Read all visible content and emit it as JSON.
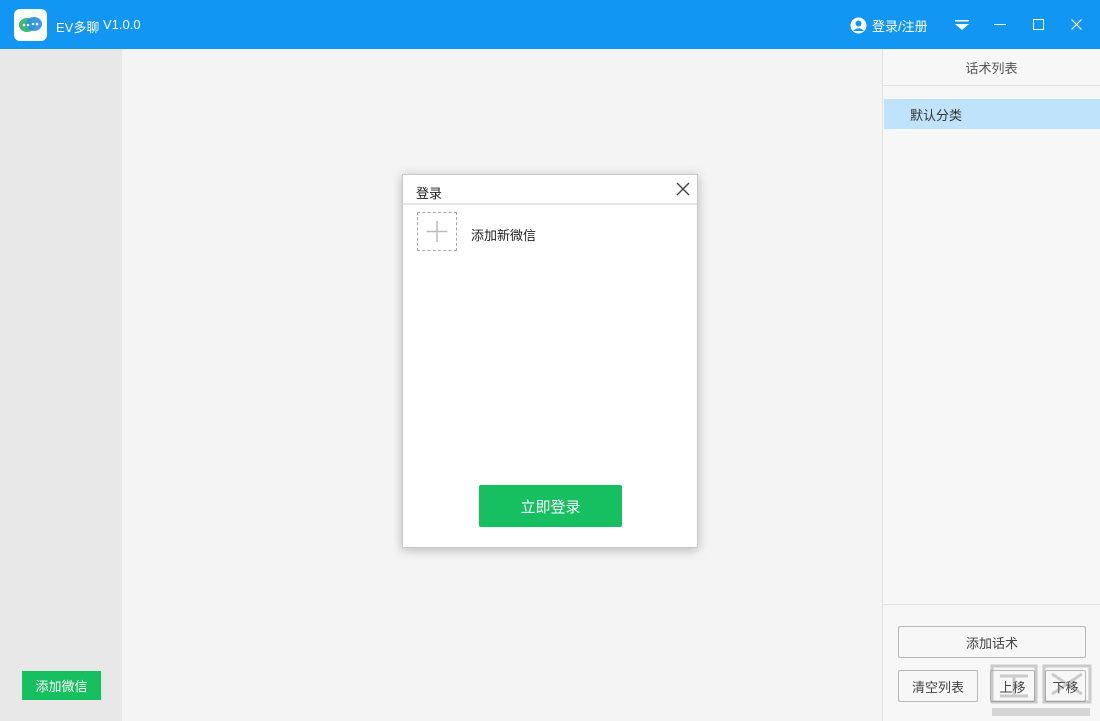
{
  "titlebar": {
    "app_name": "EV多聊",
    "version": "V1.0.0",
    "login_label": "登录/注册",
    "bg_color": "#1296f3",
    "icons": [
      "user-icon",
      "dropdown-menu-icon",
      "minimize-icon",
      "maximize-icon",
      "close-icon"
    ]
  },
  "left_sidebar": {
    "add_wechat_label": "添加微信"
  },
  "right_panel": {
    "header": "话术列表",
    "categories": [
      {
        "label": "默认分类",
        "selected": true
      }
    ],
    "add_script_label": "添加话术",
    "clear_list_label": "清空列表",
    "move_up_label": "上移",
    "move_down_label": "下移"
  },
  "login_dialog": {
    "title": "登录",
    "add_new_label": "添加新微信",
    "login_now_label": "立即登录",
    "accent_color": "#16c060"
  }
}
